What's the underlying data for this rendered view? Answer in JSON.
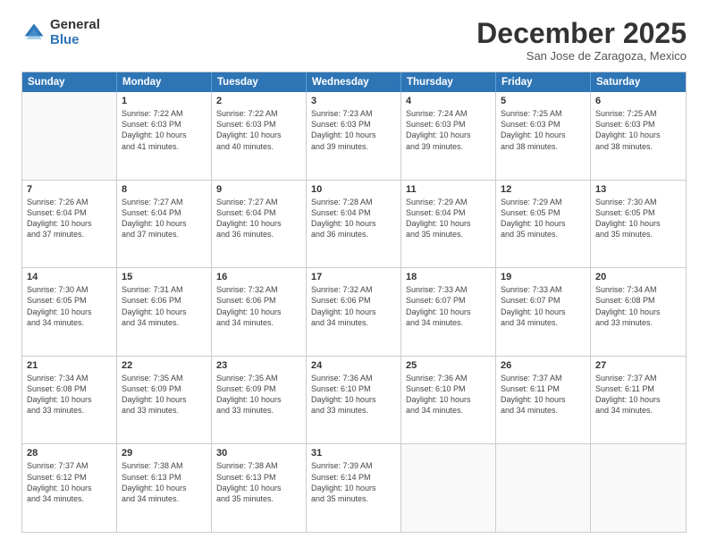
{
  "logo": {
    "general": "General",
    "blue": "Blue"
  },
  "title": "December 2025",
  "location": "San Jose de Zaragoza, Mexico",
  "header_days": [
    "Sunday",
    "Monday",
    "Tuesday",
    "Wednesday",
    "Thursday",
    "Friday",
    "Saturday"
  ],
  "weeks": [
    [
      {
        "day": "",
        "sunrise": "",
        "sunset": "",
        "daylight": ""
      },
      {
        "day": "1",
        "sunrise": "Sunrise: 7:22 AM",
        "sunset": "Sunset: 6:03 PM",
        "daylight": "Daylight: 10 hours and 41 minutes."
      },
      {
        "day": "2",
        "sunrise": "Sunrise: 7:22 AM",
        "sunset": "Sunset: 6:03 PM",
        "daylight": "Daylight: 10 hours and 40 minutes."
      },
      {
        "day": "3",
        "sunrise": "Sunrise: 7:23 AM",
        "sunset": "Sunset: 6:03 PM",
        "daylight": "Daylight: 10 hours and 39 minutes."
      },
      {
        "day": "4",
        "sunrise": "Sunrise: 7:24 AM",
        "sunset": "Sunset: 6:03 PM",
        "daylight": "Daylight: 10 hours and 39 minutes."
      },
      {
        "day": "5",
        "sunrise": "Sunrise: 7:25 AM",
        "sunset": "Sunset: 6:03 PM",
        "daylight": "Daylight: 10 hours and 38 minutes."
      },
      {
        "day": "6",
        "sunrise": "Sunrise: 7:25 AM",
        "sunset": "Sunset: 6:03 PM",
        "daylight": "Daylight: 10 hours and 38 minutes."
      }
    ],
    [
      {
        "day": "7",
        "sunrise": "Sunrise: 7:26 AM",
        "sunset": "Sunset: 6:04 PM",
        "daylight": "Daylight: 10 hours and 37 minutes."
      },
      {
        "day": "8",
        "sunrise": "Sunrise: 7:27 AM",
        "sunset": "Sunset: 6:04 PM",
        "daylight": "Daylight: 10 hours and 37 minutes."
      },
      {
        "day": "9",
        "sunrise": "Sunrise: 7:27 AM",
        "sunset": "Sunset: 6:04 PM",
        "daylight": "Daylight: 10 hours and 36 minutes."
      },
      {
        "day": "10",
        "sunrise": "Sunrise: 7:28 AM",
        "sunset": "Sunset: 6:04 PM",
        "daylight": "Daylight: 10 hours and 36 minutes."
      },
      {
        "day": "11",
        "sunrise": "Sunrise: 7:29 AM",
        "sunset": "Sunset: 6:04 PM",
        "daylight": "Daylight: 10 hours and 35 minutes."
      },
      {
        "day": "12",
        "sunrise": "Sunrise: 7:29 AM",
        "sunset": "Sunset: 6:05 PM",
        "daylight": "Daylight: 10 hours and 35 minutes."
      },
      {
        "day": "13",
        "sunrise": "Sunrise: 7:30 AM",
        "sunset": "Sunset: 6:05 PM",
        "daylight": "Daylight: 10 hours and 35 minutes."
      }
    ],
    [
      {
        "day": "14",
        "sunrise": "Sunrise: 7:30 AM",
        "sunset": "Sunset: 6:05 PM",
        "daylight": "Daylight: 10 hours and 34 minutes."
      },
      {
        "day": "15",
        "sunrise": "Sunrise: 7:31 AM",
        "sunset": "Sunset: 6:06 PM",
        "daylight": "Daylight: 10 hours and 34 minutes."
      },
      {
        "day": "16",
        "sunrise": "Sunrise: 7:32 AM",
        "sunset": "Sunset: 6:06 PM",
        "daylight": "Daylight: 10 hours and 34 minutes."
      },
      {
        "day": "17",
        "sunrise": "Sunrise: 7:32 AM",
        "sunset": "Sunset: 6:06 PM",
        "daylight": "Daylight: 10 hours and 34 minutes."
      },
      {
        "day": "18",
        "sunrise": "Sunrise: 7:33 AM",
        "sunset": "Sunset: 6:07 PM",
        "daylight": "Daylight: 10 hours and 34 minutes."
      },
      {
        "day": "19",
        "sunrise": "Sunrise: 7:33 AM",
        "sunset": "Sunset: 6:07 PM",
        "daylight": "Daylight: 10 hours and 34 minutes."
      },
      {
        "day": "20",
        "sunrise": "Sunrise: 7:34 AM",
        "sunset": "Sunset: 6:08 PM",
        "daylight": "Daylight: 10 hours and 33 minutes."
      }
    ],
    [
      {
        "day": "21",
        "sunrise": "Sunrise: 7:34 AM",
        "sunset": "Sunset: 6:08 PM",
        "daylight": "Daylight: 10 hours and 33 minutes."
      },
      {
        "day": "22",
        "sunrise": "Sunrise: 7:35 AM",
        "sunset": "Sunset: 6:09 PM",
        "daylight": "Daylight: 10 hours and 33 minutes."
      },
      {
        "day": "23",
        "sunrise": "Sunrise: 7:35 AM",
        "sunset": "Sunset: 6:09 PM",
        "daylight": "Daylight: 10 hours and 33 minutes."
      },
      {
        "day": "24",
        "sunrise": "Sunrise: 7:36 AM",
        "sunset": "Sunset: 6:10 PM",
        "daylight": "Daylight: 10 hours and 33 minutes."
      },
      {
        "day": "25",
        "sunrise": "Sunrise: 7:36 AM",
        "sunset": "Sunset: 6:10 PM",
        "daylight": "Daylight: 10 hours and 34 minutes."
      },
      {
        "day": "26",
        "sunrise": "Sunrise: 7:37 AM",
        "sunset": "Sunset: 6:11 PM",
        "daylight": "Daylight: 10 hours and 34 minutes."
      },
      {
        "day": "27",
        "sunrise": "Sunrise: 7:37 AM",
        "sunset": "Sunset: 6:11 PM",
        "daylight": "Daylight: 10 hours and 34 minutes."
      }
    ],
    [
      {
        "day": "28",
        "sunrise": "Sunrise: 7:37 AM",
        "sunset": "Sunset: 6:12 PM",
        "daylight": "Daylight: 10 hours and 34 minutes."
      },
      {
        "day": "29",
        "sunrise": "Sunrise: 7:38 AM",
        "sunset": "Sunset: 6:13 PM",
        "daylight": "Daylight: 10 hours and 34 minutes."
      },
      {
        "day": "30",
        "sunrise": "Sunrise: 7:38 AM",
        "sunset": "Sunset: 6:13 PM",
        "daylight": "Daylight: 10 hours and 35 minutes."
      },
      {
        "day": "31",
        "sunrise": "Sunrise: 7:39 AM",
        "sunset": "Sunset: 6:14 PM",
        "daylight": "Daylight: 10 hours and 35 minutes."
      },
      {
        "day": "",
        "sunrise": "",
        "sunset": "",
        "daylight": ""
      },
      {
        "day": "",
        "sunrise": "",
        "sunset": "",
        "daylight": ""
      },
      {
        "day": "",
        "sunrise": "",
        "sunset": "",
        "daylight": ""
      }
    ]
  ]
}
